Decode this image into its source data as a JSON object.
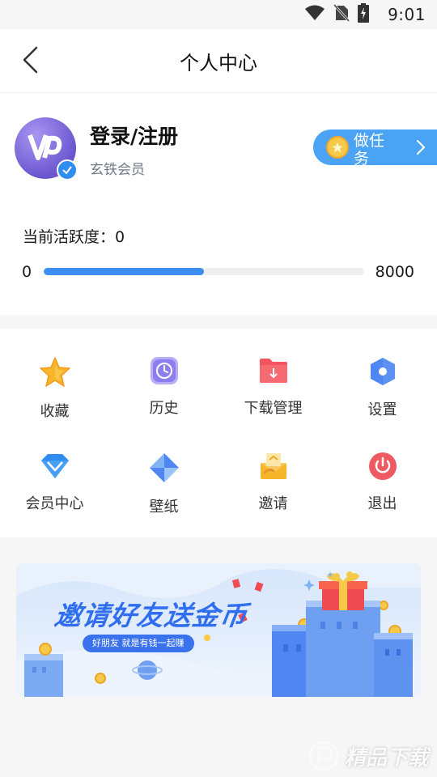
{
  "status_bar": {
    "time": "9:01",
    "icons": [
      "wifi-icon",
      "no-sim-icon",
      "battery-charging-icon"
    ]
  },
  "header": {
    "title": "个人中心",
    "back_icon": "chevron-left-icon"
  },
  "profile": {
    "username": "登录/注册",
    "member_level": "玄铁会员",
    "task_button_label": "做任务",
    "activity_label": "当前活跃度：0",
    "progress_min": "0",
    "progress_max": "8000",
    "progress_fraction": 0.5
  },
  "menu": {
    "items": [
      {
        "label": "收藏",
        "icon": "star-icon"
      },
      {
        "label": "历史",
        "icon": "clock-icon"
      },
      {
        "label": "下载管理",
        "icon": "download-folder-icon"
      },
      {
        "label": "设置",
        "icon": "settings-hexagon-icon"
      },
      {
        "label": "会员中心",
        "icon": "diamond-icon"
      },
      {
        "label": "壁纸",
        "icon": "wallpaper-icon"
      },
      {
        "label": "邀请",
        "icon": "invite-icon"
      },
      {
        "label": "退出",
        "icon": "power-icon"
      }
    ]
  },
  "banner": {
    "title": "邀请好友送金币",
    "subtitle": "好朋友  就是有钱一起赚"
  },
  "watermark": {
    "text": "精品下载"
  },
  "colors": {
    "accent_blue": "#3c8ff0",
    "task_button": "#4aa3f5",
    "avatar_purple": "#7460d8",
    "star_yellow": "#f7b52c",
    "history_purple": "#8d7ef0",
    "download_red": "#f2555f",
    "settings_blue": "#4f86f2",
    "power_red": "#ef5a62"
  }
}
